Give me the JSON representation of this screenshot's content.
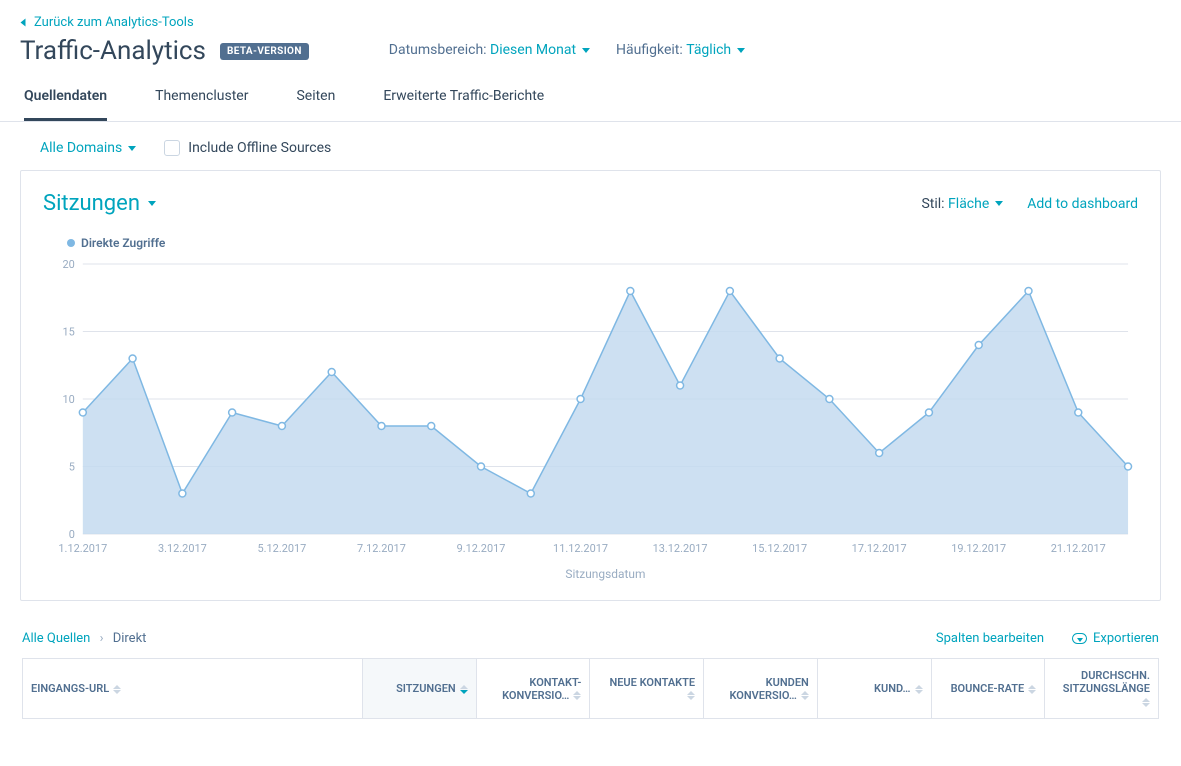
{
  "back_link": "Zurück zum Analytics-Tools",
  "page_title": "Traffic-Analytics",
  "beta_badge": "BETA-VERSION",
  "date_range": {
    "label": "Datumsbereich:",
    "value": "Diesen Monat"
  },
  "frequency": {
    "label": "Häufigkeit:",
    "value": "Täglich"
  },
  "tabs": [
    {
      "label": "Quellendaten",
      "active": true
    },
    {
      "label": "Themencluster",
      "active": false
    },
    {
      "label": "Seiten",
      "active": false
    },
    {
      "label": "Erweiterte Traffic-Berichte",
      "active": false
    }
  ],
  "filters": {
    "domains": "Alle Domains",
    "include_offline": "Include Offline Sources"
  },
  "card": {
    "metric": "Sitzungen",
    "style_label": "Stil:",
    "style_value": "Fläche",
    "add_dashboard": "Add to dashboard",
    "legend": "Direkte Zugriffe",
    "x_axis_title": "Sitzungsdatum"
  },
  "chart_data": {
    "type": "area",
    "title": "Sitzungen",
    "xlabel": "Sitzungsdatum",
    "ylabel": "",
    "ylim": [
      0,
      20
    ],
    "yticks": [
      0,
      5,
      10,
      15,
      20
    ],
    "xtick_labels": [
      "1.12.2017",
      "3.12.2017",
      "5.12.2017",
      "7.12.2017",
      "9.12.2017",
      "11.12.2017",
      "13.12.2017",
      "15.12.2017",
      "17.12.2017",
      "19.12.2017",
      "21.12.2017"
    ],
    "xtick_positions": [
      0,
      2,
      4,
      6,
      8,
      10,
      12,
      14,
      16,
      18,
      20
    ],
    "series": [
      {
        "name": "Direkte Zugriffe",
        "values": [
          9,
          13,
          3,
          9,
          8,
          12,
          8,
          8,
          5,
          3,
          10,
          18,
          11,
          18,
          13,
          10,
          6,
          9,
          14,
          18,
          9,
          5
        ]
      }
    ],
    "x_count": 22
  },
  "breadcrumb": {
    "root": "Alle Quellen",
    "current": "Direkt"
  },
  "table_actions": {
    "columns": "Spalten bearbeiten",
    "export": "Exportieren"
  },
  "table_columns": [
    {
      "label": "EINGANGS-URL",
      "align": "left"
    },
    {
      "label": "SITZUNGEN",
      "sorted": true
    },
    {
      "label": "KONTAKT-KONVERSIO…"
    },
    {
      "label": "NEUE KONTAKTE"
    },
    {
      "label": "KUNDEN KONVERSIO…"
    },
    {
      "label": "KUND…"
    },
    {
      "label": "BOUNCE-RATE"
    },
    {
      "label": "DURCHSCHN. SITZUNGSLÄNGE"
    }
  ]
}
